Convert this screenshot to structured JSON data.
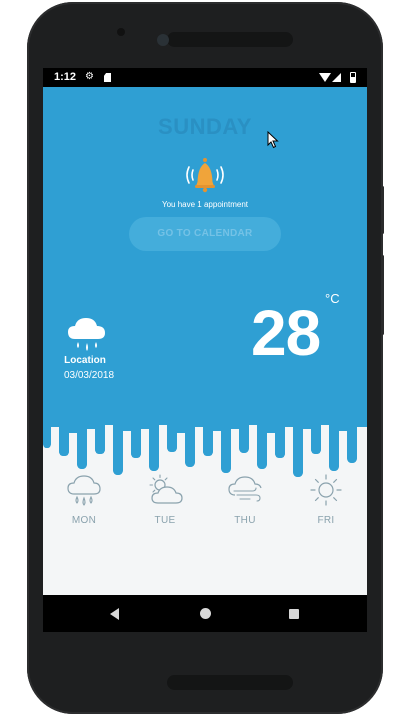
{
  "status_bar": {
    "time": "1:12",
    "icons": [
      "gear-icon",
      "sd-card-icon",
      "wifi-icon",
      "signal-icon",
      "battery-icon"
    ]
  },
  "header": {
    "day": "SUNDAY"
  },
  "notification": {
    "icon": "bell-icon",
    "text": "You have 1 appointment"
  },
  "calendar_button": {
    "label": "GO TO CALENDAR"
  },
  "current": {
    "icon": "rain-cloud-icon",
    "location": "Location",
    "date": "03/03/2018",
    "unit": "°C",
    "temperature": "28"
  },
  "forecast": [
    {
      "day": "MON",
      "icon": "rain-cloud-icon"
    },
    {
      "day": "TUE",
      "icon": "partly-cloudy-icon"
    },
    {
      "day": "THU",
      "icon": "windy-cloud-icon"
    },
    {
      "day": "FRI",
      "icon": "sun-icon"
    }
  ],
  "colors": {
    "primary": "#2f9fd3",
    "bell": "#f0a43a",
    "forecast_background": "#f4f6f7",
    "forecast_text": "#8aa2ad"
  }
}
